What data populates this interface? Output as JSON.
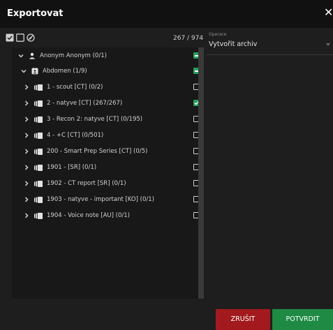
{
  "window": {
    "title": "Exportovat",
    "close_glyph": "✕"
  },
  "toolbar": {
    "count": "267 / 974",
    "icons": [
      "select-all-icon",
      "select-none-icon",
      "invert-selection-icon"
    ]
  },
  "operation": {
    "label": "Operace",
    "value": "Vytvořit archiv"
  },
  "tree": [
    {
      "label": "Anonym Anonym (0/1)",
      "level": 0,
      "expand": "down",
      "icon": "person-icon",
      "check": "indeterminate"
    },
    {
      "label": "Abdomen (1/9)",
      "level": 1,
      "expand": "down",
      "icon": "study-icon",
      "check": "indeterminate"
    },
    {
      "label": "1 - scout [CT] (0/2)",
      "level": 2,
      "expand": "right",
      "icon": "series-icon",
      "check": "unchecked"
    },
    {
      "label": "2 - natyve [CT] (267/267)",
      "level": 2,
      "expand": "right",
      "icon": "series-icon",
      "check": "checked"
    },
    {
      "label": "3 - Recon 2: natyve [CT] (0/195)",
      "level": 2,
      "expand": "right",
      "icon": "series-icon",
      "check": "unchecked"
    },
    {
      "label": "4 - +C [CT] (0/501)",
      "level": 2,
      "expand": "right",
      "icon": "series-icon",
      "check": "unchecked"
    },
    {
      "label": "200 - Smart Prep Series [CT] (0/5)",
      "level": 2,
      "expand": "right",
      "icon": "series-icon",
      "check": "unchecked"
    },
    {
      "label": "1901 - [SR] (0/1)",
      "level": 2,
      "expand": "right",
      "icon": "series-icon",
      "check": "unchecked"
    },
    {
      "label": "1902 - CT report [SR] (0/1)",
      "level": 2,
      "expand": "right",
      "icon": "series-icon",
      "check": "unchecked"
    },
    {
      "label": "1903 - natyve - important [KO] (0/1)",
      "level": 2,
      "expand": "right",
      "icon": "series-icon",
      "check": "unchecked"
    },
    {
      "label": "1904 - Voice note [AU] (0/1)",
      "level": 2,
      "expand": "right",
      "icon": "series-icon",
      "check": "unchecked"
    }
  ],
  "buttons": {
    "cancel": "ZRUŠIT",
    "confirm": "POTVRDIT"
  },
  "colors": {
    "accent_green": "#27a15a",
    "cancel_red": "#a21a1d",
    "confirm_green": "#1e8a44",
    "titlebar": "#111111"
  }
}
